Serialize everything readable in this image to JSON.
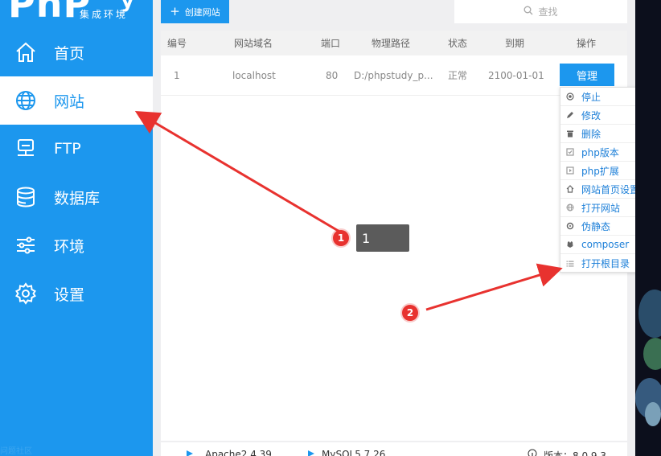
{
  "brand": {
    "logo_text": "PhP",
    "logo_tail": "y",
    "subtitle": "集成环境",
    "color": "#1c97ee"
  },
  "sidebar": {
    "items": [
      {
        "label": "首页",
        "icon": "home-icon",
        "active": false
      },
      {
        "label": "网站",
        "icon": "globe-icon",
        "active": true
      },
      {
        "label": "FTP",
        "icon": "server-icon",
        "active": false
      },
      {
        "label": "数据库",
        "icon": "database-icon",
        "active": false
      },
      {
        "label": "环境",
        "icon": "sliders-icon",
        "active": false
      },
      {
        "label": "设置",
        "icon": "gear-icon",
        "active": false
      }
    ],
    "watermark": "问题社区"
  },
  "toolbar": {
    "create_label": "创建网站",
    "search_placeholder": "查找"
  },
  "table": {
    "headers": [
      "编号",
      "网站域名",
      "端口",
      "物理路径",
      "状态",
      "到期",
      "操作"
    ],
    "rows": [
      {
        "id": "1",
        "domain": "localhost",
        "port": "80",
        "path": "D:/phpstudy_p...",
        "status": "正常",
        "expires": "2100-01-01",
        "action": "管理"
      }
    ]
  },
  "dropdown": {
    "items": [
      {
        "label": "停止",
        "icon": "stop-icon"
      },
      {
        "label": "修改",
        "icon": "pencil-icon"
      },
      {
        "label": "删除",
        "icon": "trash-icon"
      },
      {
        "label": "php版本",
        "icon": "php-version-icon"
      },
      {
        "label": "php扩展",
        "icon": "php-extension-icon"
      },
      {
        "label": "网站首页设置",
        "icon": "home-page-icon"
      },
      {
        "label": "打开网站",
        "icon": "globe-icon"
      },
      {
        "label": "伪静态",
        "icon": "rewrite-icon"
      },
      {
        "label": "composer",
        "icon": "composer-icon"
      },
      {
        "label": "打开根目录",
        "icon": "list-icon"
      }
    ]
  },
  "status_bar": {
    "apache": "Apache2.4.39",
    "mysql": "MySQL5.7.26",
    "version": "版本：8.0.9.3"
  },
  "annotations": {
    "badge1": "1",
    "badge2": "2",
    "tooltip": "1",
    "color": "#e8322f"
  }
}
